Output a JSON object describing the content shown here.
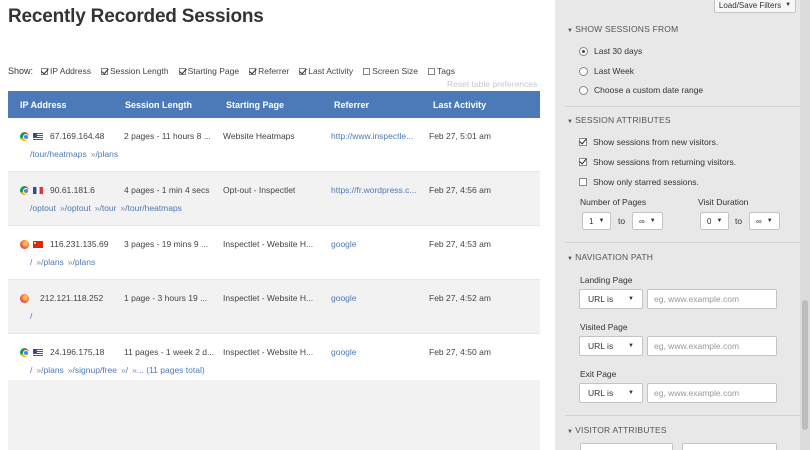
{
  "page_title": "Recently Recorded Sessions",
  "show": {
    "label": "Show:",
    "options": [
      {
        "label": "IP Address",
        "checked": true
      },
      {
        "label": "Session Length",
        "checked": true
      },
      {
        "label": "Starting Page",
        "checked": true
      },
      {
        "label": "Referrer",
        "checked": true
      },
      {
        "label": "Last Activity",
        "checked": true
      },
      {
        "label": "Screen Size",
        "checked": false
      },
      {
        "label": "Tags",
        "checked": false
      }
    ]
  },
  "reset_link": "Reset table preferences",
  "table": {
    "headers": [
      "IP Address",
      "Session Length",
      "Starting Page",
      "Referrer",
      "Last Activity"
    ],
    "rows": [
      {
        "browser": "chrome",
        "flag": "us",
        "ip": "67.169.164.48",
        "length": "2 pages - 11 hours 8 ...",
        "start": "Website Heatmaps",
        "referrer": "http://www.inspectle...",
        "last": "Feb 27, 5:01 am",
        "path": [
          "/tour/heatmaps",
          "/plans"
        ]
      },
      {
        "browser": "chrome",
        "flag": "fr",
        "ip": "90.61.181.6",
        "length": "4 pages - 1 min 4 secs",
        "start": "Opt-out - Inspectlet",
        "referrer": "https://fr.wordpress.c...",
        "last": "Feb 27, 4:56 am",
        "path": [
          "/optout",
          "/optout",
          "/tour",
          "/tour/heatmaps"
        ]
      },
      {
        "browser": "firefox",
        "flag": "cn",
        "ip": "116.231.135.69",
        "length": "3 pages - 19 mins 9 ...",
        "start": "Inspectlet - Website H...",
        "referrer": "google",
        "last": "Feb 27, 4:53 am",
        "path": [
          "/",
          "/plans",
          "/plans"
        ]
      },
      {
        "browser": "firefox",
        "flag": "",
        "ip": "212.121.118.252",
        "length": "1 page - 3 hours 19 ...",
        "start": "Inspectlet - Website H...",
        "referrer": "google",
        "last": "Feb 27, 4:52 am",
        "path": [
          "/"
        ]
      },
      {
        "browser": "chrome",
        "flag": "us",
        "ip": "24.196.175.18",
        "length": "11 pages - 1 week 2 d...",
        "start": "Inspectlet - Website H...",
        "referrer": "google",
        "last": "Feb 27, 4:50 am",
        "path": [
          "/",
          "/plans",
          "/signup/free",
          "/",
          "... (11 pages total)"
        ]
      }
    ]
  },
  "sidebar": {
    "load_save": "Load/Save Filters",
    "sessions_from": {
      "title": "SHOW SESSIONS FROM",
      "options": [
        {
          "label": "Last 30 days",
          "selected": true
        },
        {
          "label": "Last Week",
          "selected": false
        },
        {
          "label": "Choose a custom date range",
          "selected": false
        }
      ]
    },
    "attributes": {
      "title": "SESSION ATTRIBUTES",
      "options": [
        {
          "label": "Show sessions from new visitors.",
          "checked": true
        },
        {
          "label": "Show sessions from returning visitors.",
          "checked": true
        },
        {
          "label": "Show only starred sessions.",
          "checked": false
        }
      ],
      "pages_label": "Number of Pages",
      "duration_label": "Visit Duration",
      "pages_from": "1",
      "pages_to": "∞",
      "duration_from": "0",
      "duration_to": "∞",
      "to": "to"
    },
    "navigation": {
      "title": "NAVIGATION PATH",
      "fields": [
        {
          "label": "Landing Page",
          "op": "URL is",
          "placeholder": "eg, www.example.com"
        },
        {
          "label": "Visited Page",
          "op": "URL is",
          "placeholder": "eg, www.example.com"
        },
        {
          "label": "Exit Page",
          "op": "URL is",
          "placeholder": "eg, www.example.com"
        }
      ]
    },
    "visitor": {
      "title": "VISITOR ATTRIBUTES"
    }
  }
}
